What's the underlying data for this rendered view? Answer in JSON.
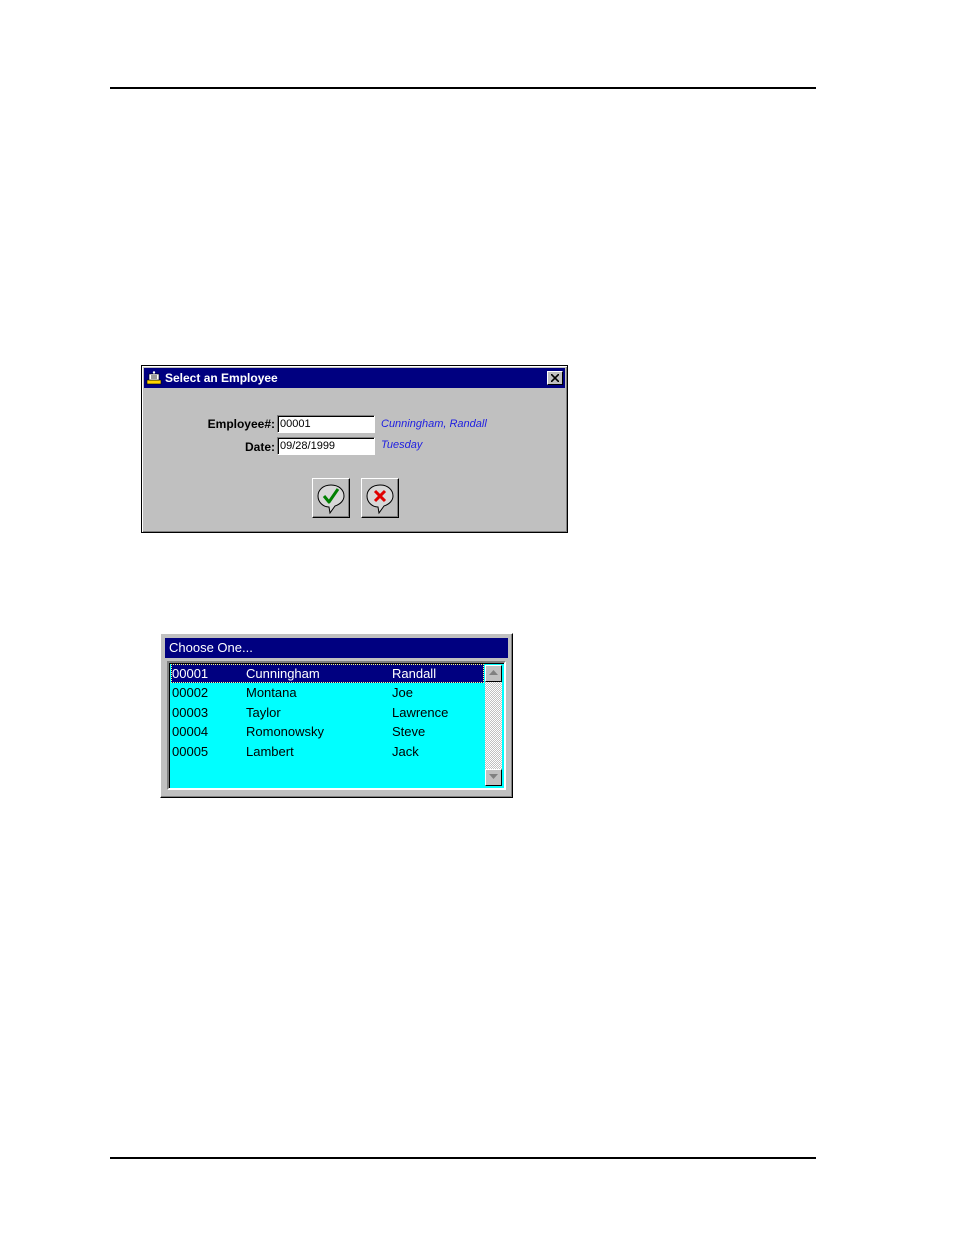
{
  "dialog": {
    "title": "Select an Employee",
    "employee_label": "Employee#:",
    "employee_value": "00001",
    "employee_name": "Cunningham, Randall",
    "date_label": "Date:",
    "date_value": "09/28/1999",
    "weekday": "Tuesday",
    "ok_icon": "check-icon",
    "cancel_icon": "x-icon"
  },
  "picker": {
    "title": "Choose One...",
    "rows": [
      {
        "id": "00001",
        "last": "Cunningham",
        "first": "Randall"
      },
      {
        "id": "00002",
        "last": "Montana",
        "first": "Joe"
      },
      {
        "id": "00003",
        "last": "Taylor",
        "first": "Lawrence"
      },
      {
        "id": "00004",
        "last": "Romonowsky",
        "first": "Steve"
      },
      {
        "id": "00005",
        "last": "Lambert",
        "first": "Jack"
      }
    ],
    "selected_index": 0
  },
  "colors": {
    "titlebar": "#000080",
    "list_bg": "#00ffff",
    "hint_text": "#2020e0",
    "ok_green": "#008000",
    "cancel_red": "#e00000"
  }
}
